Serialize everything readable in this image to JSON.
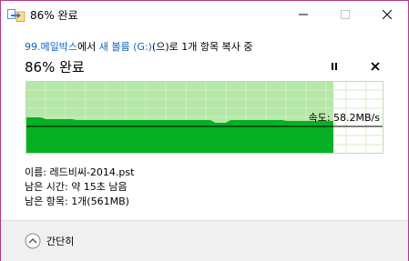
{
  "window": {
    "title": "86% 완료",
    "title_icon": "file-copy-icon",
    "minimize_icon": "minimize-icon",
    "maximize_icon": "maximize-icon",
    "close_icon": "close-icon"
  },
  "header": {
    "source": "99.메일박스",
    "from_suffix": "에서 ",
    "destination": "새 볼륨 (G:)",
    "to_suffix": "(으)로 1개 항목 복사 중",
    "percent_title": "86% 완료"
  },
  "controls": {
    "pause_icon": "pause-icon",
    "cancel_icon": "cancel-icon"
  },
  "graph": {
    "progress_fraction": 0.86,
    "speed_text": "속도: 58.2MB/s",
    "colors": {
      "background_progress": "#b5e8a6",
      "speed_fill": "#06b025",
      "remaining": "#ffffff",
      "grid": "#cfe9c6",
      "speed_line": "#000000"
    }
  },
  "details": {
    "name_label": "이름: ",
    "name_value": "레드비씨-2014.pst",
    "time_label": "남은 시간: ",
    "time_value": "약 15초 남음",
    "items_label": "남은 항목: ",
    "items_value": "1개(561MB)"
  },
  "footer": {
    "toggle_icon": "chevron-up-circle-icon",
    "toggle_label": "간단히"
  }
}
